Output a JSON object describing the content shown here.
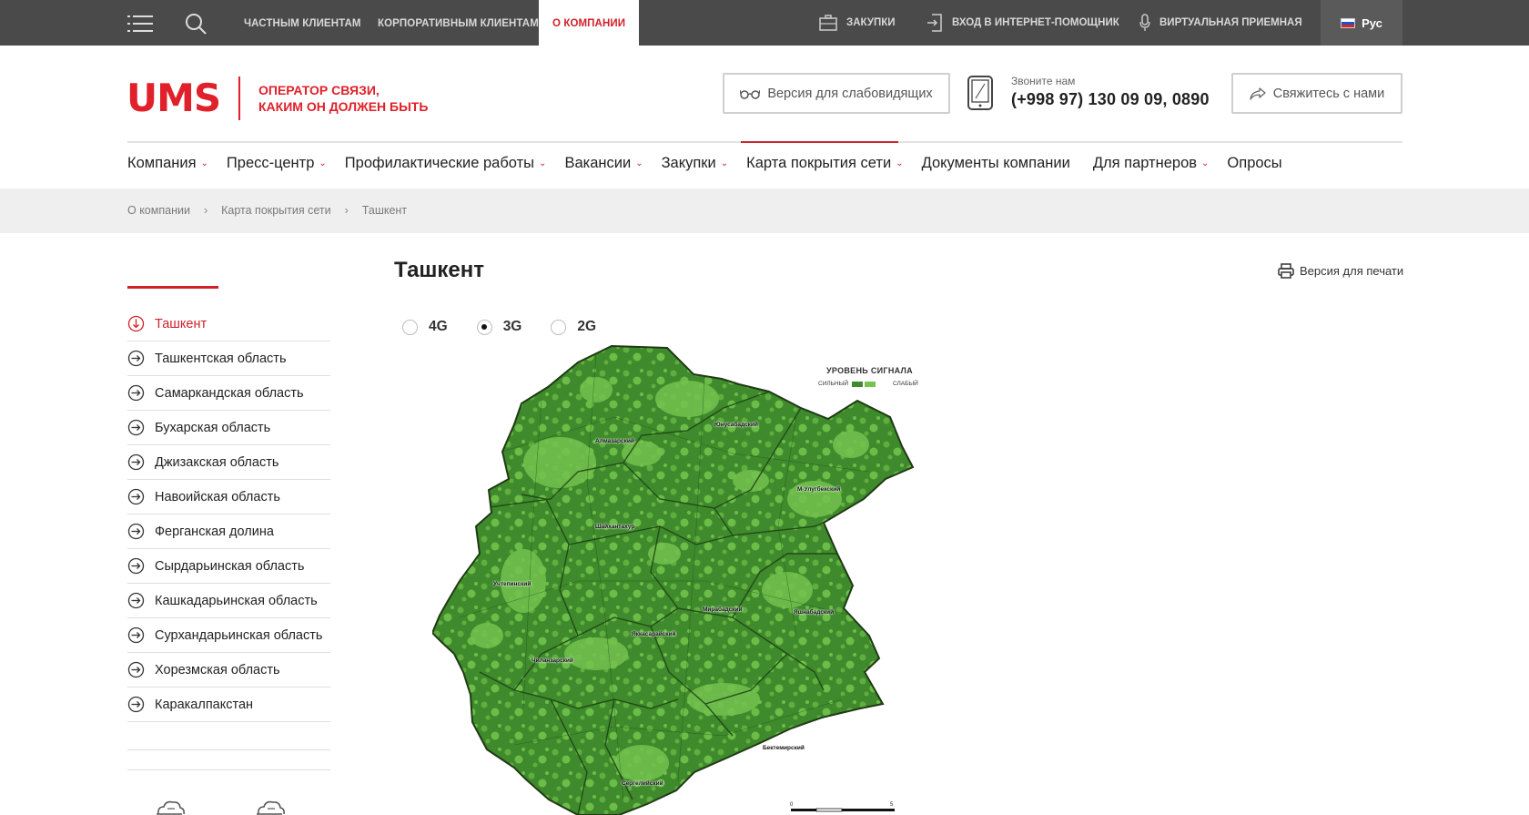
{
  "topbar": {
    "links": [
      {
        "label": "ЧАСТНЫМ КЛИЕНТАМ"
      },
      {
        "label": "КОРПОРАТИВНЫМ КЛИЕНТАМ"
      },
      {
        "label": "О КОМПАНИИ"
      }
    ],
    "purchases": "ЗАКУПКИ",
    "login": "ВХОД В ИНТЕРНЕТ-ПОМОЩНИК",
    "reception": "ВИРТУАЛЬНАЯ ПРИЕМНАЯ",
    "lang": "Рус"
  },
  "header": {
    "logo": "UMS",
    "tagline_line1": "ОПЕРАТОР СВЯЗИ,",
    "tagline_line2": "КАКИМ ОН ДОЛЖЕН БЫТЬ",
    "low_vision": "Версия для слабовидящих",
    "phone_label": "Звоните нам",
    "phone_number": "(+998 97) 130 09 09, 0890",
    "contact": "Свяжитесь с нами"
  },
  "nav": [
    {
      "label": "Компания",
      "caret": "⌄"
    },
    {
      "label": "Пресс-центр",
      "caret": "⌄"
    },
    {
      "label": "Профилактические работы",
      "caret": "⌄"
    },
    {
      "label": "Вакансии",
      "caret": "⌄"
    },
    {
      "label": "Закупки",
      "caret": "⌄"
    },
    {
      "label": "Карта покрытия сети",
      "caret": "⌄"
    },
    {
      "label": "Документы компании",
      "caret": ""
    },
    {
      "label": "Для партнеров",
      "caret": "⌄"
    },
    {
      "label": "Опросы",
      "caret": ""
    }
  ],
  "breadcrumb": [
    "О компании",
    "Карта покрытия сети",
    "Ташкент"
  ],
  "breadcrumb_sep": "›",
  "sidebar": [
    {
      "label": "Ташкент",
      "active": true
    },
    {
      "label": "Ташкентская область"
    },
    {
      "label": "Самаркандская область"
    },
    {
      "label": "Бухарская область"
    },
    {
      "label": "Джизакская область"
    },
    {
      "label": "Навоийская область"
    },
    {
      "label": "Ферганская долина"
    },
    {
      "label": "Сырдарьинская область"
    },
    {
      "label": "Кашкадарьинская область"
    },
    {
      "label": "Сурхандарьинская область"
    },
    {
      "label": "Хорезмская область"
    },
    {
      "label": "Каракалпакстан"
    }
  ],
  "main": {
    "title": "Ташкент",
    "print": "Версия для печати",
    "tech": [
      {
        "label": "4G",
        "checked": false
      },
      {
        "label": "3G",
        "checked": true
      },
      {
        "label": "2G",
        "checked": false
      }
    ]
  },
  "map": {
    "legend_title": "УРОВЕНЬ СИГНАЛА",
    "legend_strong": "СИЛЬНЫЙ",
    "legend_weak": "СЛАБЫЙ",
    "strong_color": "#3f8a2c",
    "weak_color": "#74c24f",
    "districts": [
      {
        "name": "Алмазарский"
      },
      {
        "name": "Юнусабадский"
      },
      {
        "name": "М-Улугбекский"
      },
      {
        "name": "Шайхантахур"
      },
      {
        "name": "Учтепинский"
      },
      {
        "name": "Мирабадский"
      },
      {
        "name": "Яшнабадский"
      },
      {
        "name": "Яккасарайский"
      },
      {
        "name": "Чиланзарский"
      },
      {
        "name": "Бектемирский"
      },
      {
        "name": "Сергелийский"
      }
    ],
    "scale_start": "0",
    "scale_end": "5"
  },
  "colors": {
    "brand_red": "#d0202a",
    "topbar": "#4a4a4a"
  }
}
